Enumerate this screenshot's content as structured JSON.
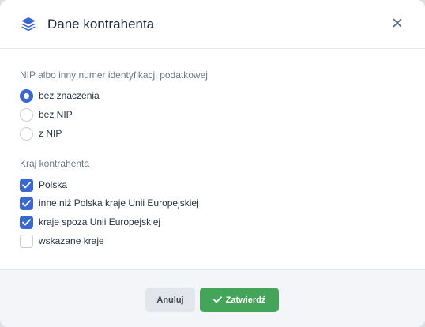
{
  "dialog": {
    "title": "Dane kontrahenta",
    "close_icon": "close-icon",
    "header_icon": "layers-icon"
  },
  "nip_section": {
    "label": "NIP albo inny numer identyfikacji podatkowej",
    "options": [
      {
        "label": "bez znaczenia",
        "selected": true
      },
      {
        "label": "bez NIP",
        "selected": false
      },
      {
        "label": "z NIP",
        "selected": false
      }
    ]
  },
  "country_section": {
    "label": "Kraj kontrahenta",
    "options": [
      {
        "label": "Polska",
        "checked": true
      },
      {
        "label": "inne niż Polska kraje Unii Europejskiej",
        "checked": true
      },
      {
        "label": "kraje spoza Unii Europejskiej",
        "checked": true
      },
      {
        "label": "wskazane kraje",
        "checked": false
      }
    ]
  },
  "footer": {
    "cancel_label": "Anuluj",
    "confirm_label": "Zatwierdź",
    "confirm_icon": "check-icon"
  },
  "colors": {
    "accent": "#3a67d0",
    "confirm": "#44a55a"
  }
}
